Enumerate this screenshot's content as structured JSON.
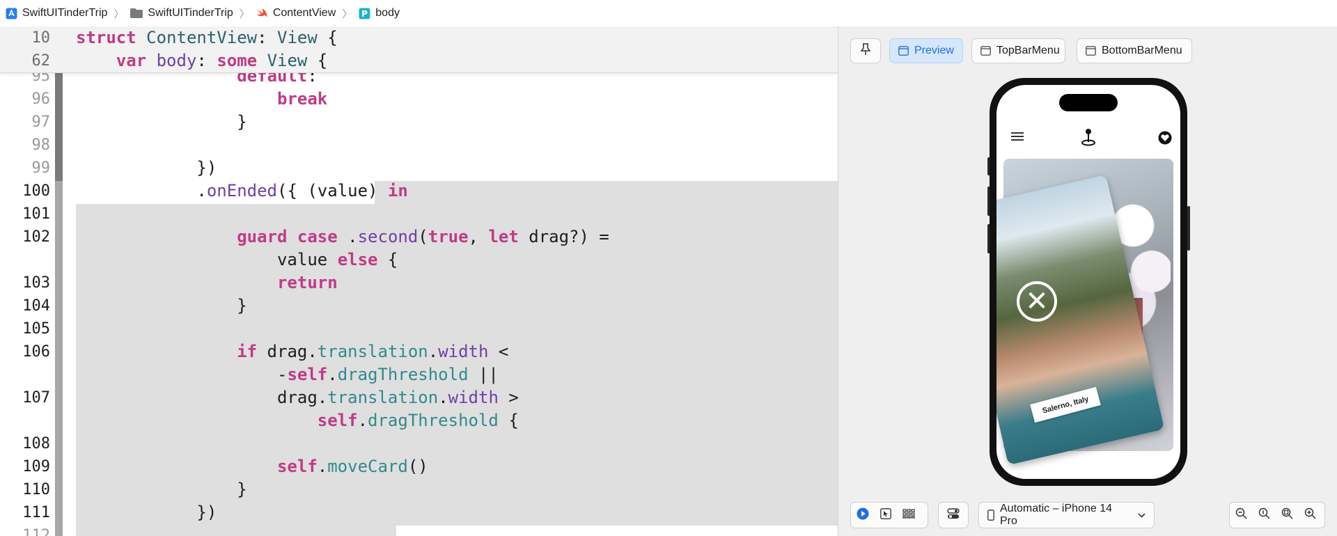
{
  "breadcrumb": [
    {
      "label": "SwiftUITinderTrip",
      "icon": "app-project-icon"
    },
    {
      "label": "SwiftUITinderTrip",
      "icon": "folder-icon"
    },
    {
      "label": "ContentView",
      "icon": "swift-file-icon"
    },
    {
      "label": "body",
      "icon": "property-icon"
    }
  ],
  "sticky": [
    {
      "ln": "10"
    },
    {
      "ln": "62"
    }
  ],
  "lines": [
    {
      "ln": "95"
    },
    {
      "ln": "96"
    },
    {
      "ln": "97"
    },
    {
      "ln": "98"
    },
    {
      "ln": "99"
    },
    {
      "ln": "100"
    },
    {
      "ln": "101"
    },
    {
      "ln": "102"
    },
    {
      "ln": ""
    },
    {
      "ln": "103"
    },
    {
      "ln": "104"
    },
    {
      "ln": "105"
    },
    {
      "ln": "106"
    },
    {
      "ln": ""
    },
    {
      "ln": "107"
    },
    {
      "ln": ""
    },
    {
      "ln": "108"
    },
    {
      "ln": "109"
    },
    {
      "ln": "110"
    },
    {
      "ln": "111"
    },
    {
      "ln": "112"
    }
  ],
  "preview": {
    "pin_icon": "pin-icon",
    "tabs": [
      {
        "label": "Preview",
        "active": true
      },
      {
        "label": "TopBarMenu",
        "active": false
      },
      {
        "label": "BottomBarMenu",
        "active": false
      }
    ],
    "device": "Automatic – iPhone 14 Pro",
    "location": "Salerno, Italy",
    "reject_glyph": "✕"
  },
  "colors": {
    "keyword": "#c03b86",
    "type": "#2a6173",
    "function": "#6f3fa8",
    "property": "#2f8a8e",
    "active_tab": "#1f6fe0"
  }
}
